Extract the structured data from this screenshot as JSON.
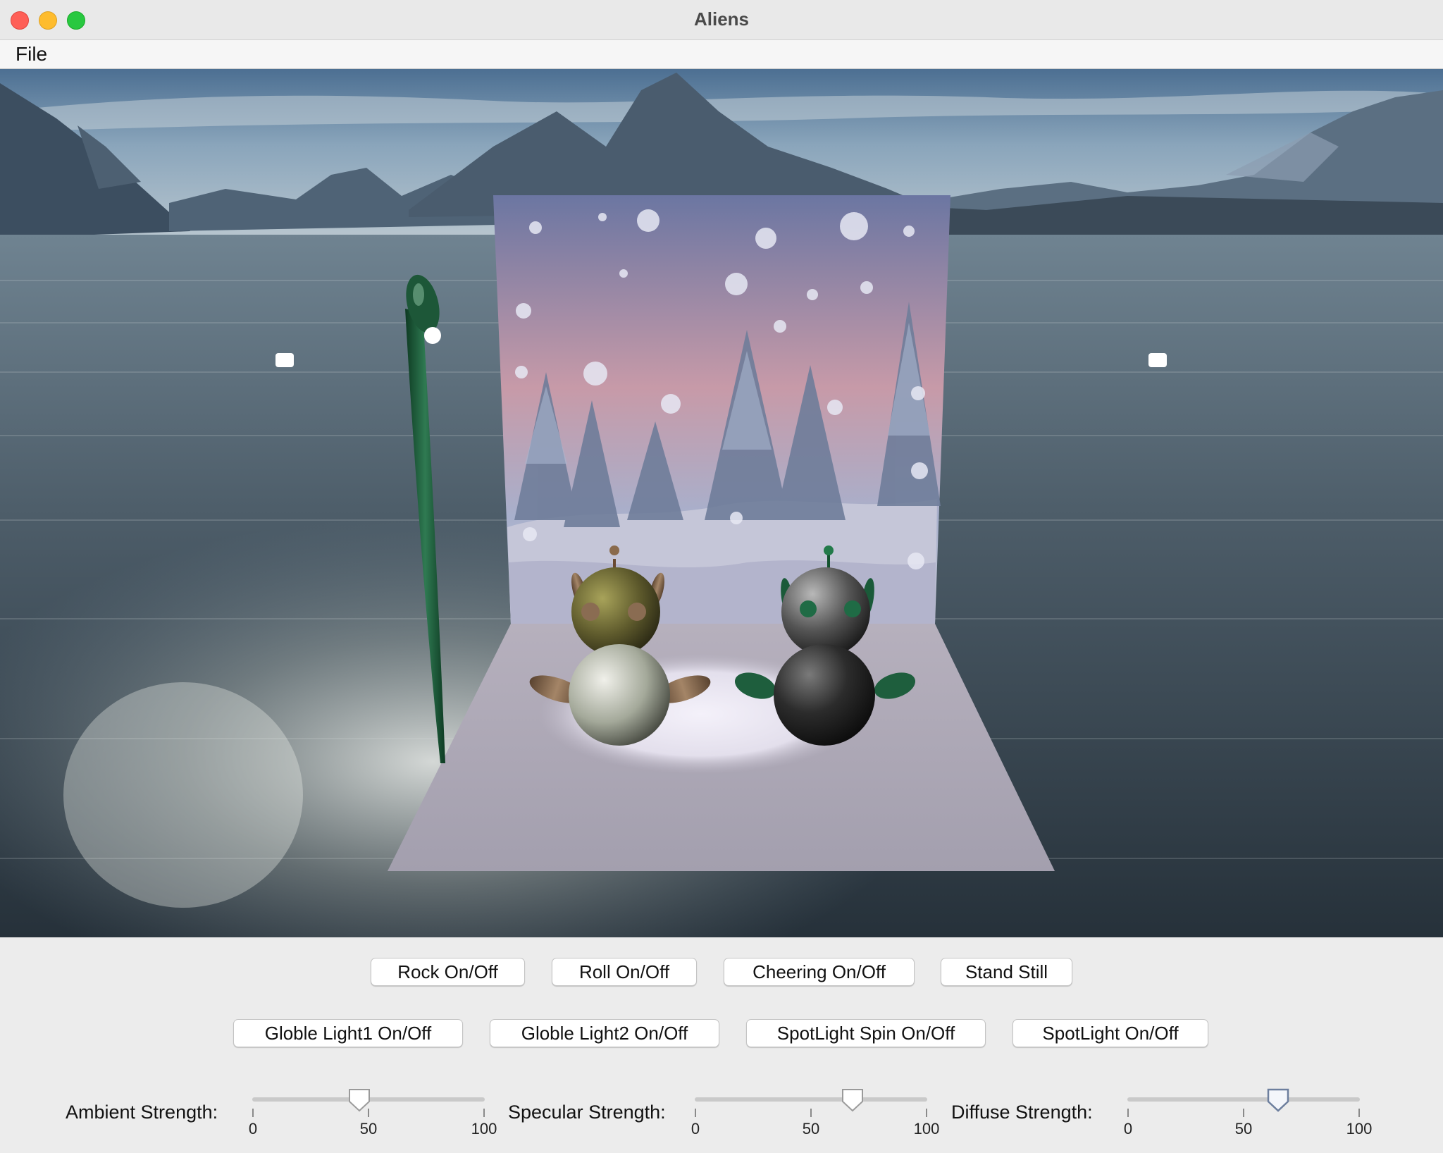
{
  "window": {
    "title": "Aliens"
  },
  "menubar": {
    "items": [
      {
        "label": "File"
      }
    ]
  },
  "buttons_row1": [
    {
      "label": "Rock On/Off"
    },
    {
      "label": "Roll On/Off"
    },
    {
      "label": "Cheering On/Off"
    },
    {
      "label": "Stand Still"
    }
  ],
  "buttons_row2": [
    {
      "label": "Globle Light1 On/Off"
    },
    {
      "label": "Globle Light2 On/Off"
    },
    {
      "label": "SpotLight Spin On/Off"
    },
    {
      "label": "SpotLight On/Off"
    }
  ],
  "sliders": [
    {
      "label": "Ambient Strength:",
      "min": "0",
      "mid": "50",
      "max": "100",
      "value": 46
    },
    {
      "label": "Specular Strength:",
      "min": "0",
      "mid": "50",
      "max": "100",
      "value": 68
    },
    {
      "label": "Diffuse Strength:",
      "min": "0",
      "mid": "50",
      "max": "100",
      "value": 65
    }
  ],
  "scene": {
    "description_icons": [
      "alien-left",
      "alien-right",
      "lamp-post",
      "snowy-backdrop",
      "lake-skybox"
    ]
  }
}
